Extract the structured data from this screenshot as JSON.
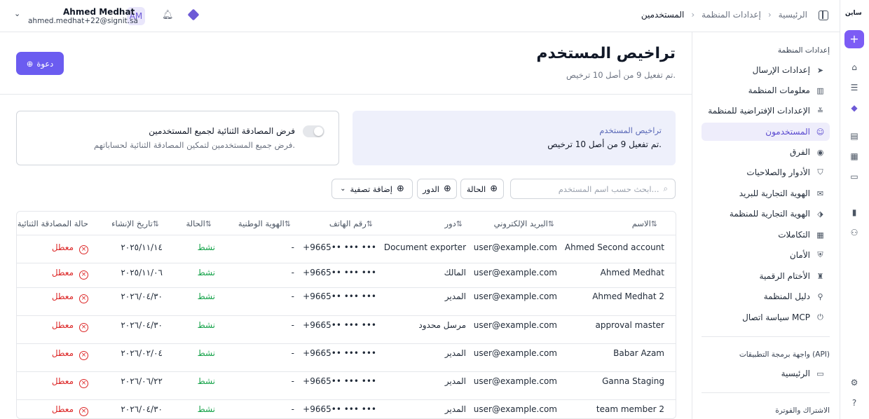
{
  "rail": {
    "logo_text": "ساين",
    "icons": [
      "plus-icon",
      "home-icon",
      "tasks-icon",
      "brand-diamond-icon",
      "templates-icon",
      "documents-icon",
      "folder-icon",
      "reports-icon",
      "workflow-icon",
      "settings-icon",
      "help-icon"
    ]
  },
  "topbar": {
    "breadcrumb": [
      "الرئيسية",
      "إعدادات المنظمة",
      "المستخدمين"
    ],
    "user_name": "Ahmed Medhat",
    "user_email": "ahmed.medhat+22@signit.sa",
    "avatar_initials": "AM"
  },
  "sidebar": {
    "group_org": "إعدادات المنظمة",
    "items": [
      {
        "label": "إعدادات الإرسال",
        "icon": "send-icon"
      },
      {
        "label": "معلومات المنظمة",
        "icon": "building-icon"
      },
      {
        "label": "الإعدادات الإفتراضية للمنظمة",
        "icon": "sliders-icon"
      },
      {
        "label": "المستخدمون",
        "icon": "users-icon",
        "active": true
      },
      {
        "label": "الفرق",
        "icon": "team-icon"
      },
      {
        "label": "الأدوار والصلاحيات",
        "icon": "shield-icon"
      },
      {
        "label": "الهوية التجارية للبريد",
        "icon": "mail-icon"
      },
      {
        "label": "الهوية التجارية للمنظمة",
        "icon": "tag-icon"
      },
      {
        "label": "التكاملات",
        "icon": "grid-icon"
      },
      {
        "label": "الأمان",
        "icon": "lock-shield-icon"
      },
      {
        "label": "الأختام الرقمية",
        "icon": "stamp-icon"
      },
      {
        "label": "دليل المنظمة",
        "icon": "directory-icon"
      },
      {
        "label": "سياسة اتصال MCP",
        "icon": "plug-icon"
      }
    ],
    "group_api": "واجهة برمجة التطبيقات (API)",
    "api_home": "الرئيسية",
    "group_billing": "الاشتراك والفوترة"
  },
  "main": {
    "title": "تراخيص المستخدم",
    "subtitle": "تم تفعيل 9 من أصل 10 ترخيص.",
    "invite_label": "دعوة",
    "license_label": "تراخيص المستخدم",
    "license_value": "تم تفعيل 9 من أصل 10 ترخيص.",
    "twofa_title": "فرض المصادقة الثنائية لجميع المستخدمين",
    "twofa_desc": "فرض جميع المستخدمين لتمكين المصادقة الثنائية لحساباتهم.",
    "twofa_enabled": false,
    "search_placeholder": "ابحث حسب اسم المستخدم...",
    "filter_status": "الحالة",
    "filter_role": "الدور",
    "filter_add": "إضافة تصفية"
  },
  "table": {
    "headers": [
      "الاسم",
      "البريد الإلكتروني",
      "دور",
      "رقم الهاتف",
      "الهوية الوطنية",
      "الحالة",
      "تاريخ الإنشاء",
      "حالة المصادقة الثنائية"
    ],
    "rows": [
      {
        "name": "Ahmed Second account",
        "email": "user@example.com",
        "role": "Document exporter",
        "phone": "+9665•• ••• •••",
        "national_id": "-",
        "status": "نشط",
        "created": "٢٠٢٥/١١/١٤",
        "twofa": "معطل"
      },
      {
        "name": "Ahmed Medhat",
        "email": "user@example.com",
        "role": "المالك",
        "phone": "+9665•• ••• •••",
        "national_id": "-",
        "status": "نشط",
        "created": "٢٠٢٥/١١/٠٦",
        "twofa": "معطل"
      },
      {
        "name": "Ahmed Medhat 2",
        "email": "user@example.com",
        "role": "المدير",
        "phone": "+9665•• ••• •••",
        "national_id": "-",
        "status": "نشط",
        "created": "٢٠٢٦/٠٤/٣٠",
        "twofa": "معطل"
      },
      {
        "name": "approval master",
        "email": "user@example.com",
        "role": "مرسل محدود",
        "phone": "+9665•• ••• •••",
        "national_id": "-",
        "status": "نشط",
        "created": "٢٠٢٦/٠٤/٣٠",
        "twofa": "معطل"
      },
      {
        "name": "Babar Azam",
        "email": "user@example.com",
        "role": "المدير",
        "phone": "+9665•• ••• •••",
        "national_id": "-",
        "status": "نشط",
        "created": "٢٠٢٦/٠٢/٠٤",
        "twofa": "معطل"
      },
      {
        "name": "Ganna Staging",
        "email": "user@example.com",
        "role": "المدير",
        "phone": "+9665•• ••• •••",
        "national_id": "-",
        "status": "نشط",
        "created": "٢٠٢٦/٠٦/٢٢",
        "twofa": "معطل"
      },
      {
        "name": "team member 2",
        "email": "user@example.com",
        "role": "المدير",
        "phone": "+9665•• ••• •••",
        "national_id": "-",
        "status": "نشط",
        "created": "٢٠٢٦/٠٤/٣٠",
        "twofa": "معطل"
      }
    ]
  },
  "colors": {
    "accent": "#6b5cf0",
    "active_bg": "#eeedfb",
    "status_active": "#16a34a",
    "status_disabled": "#dc2626"
  }
}
